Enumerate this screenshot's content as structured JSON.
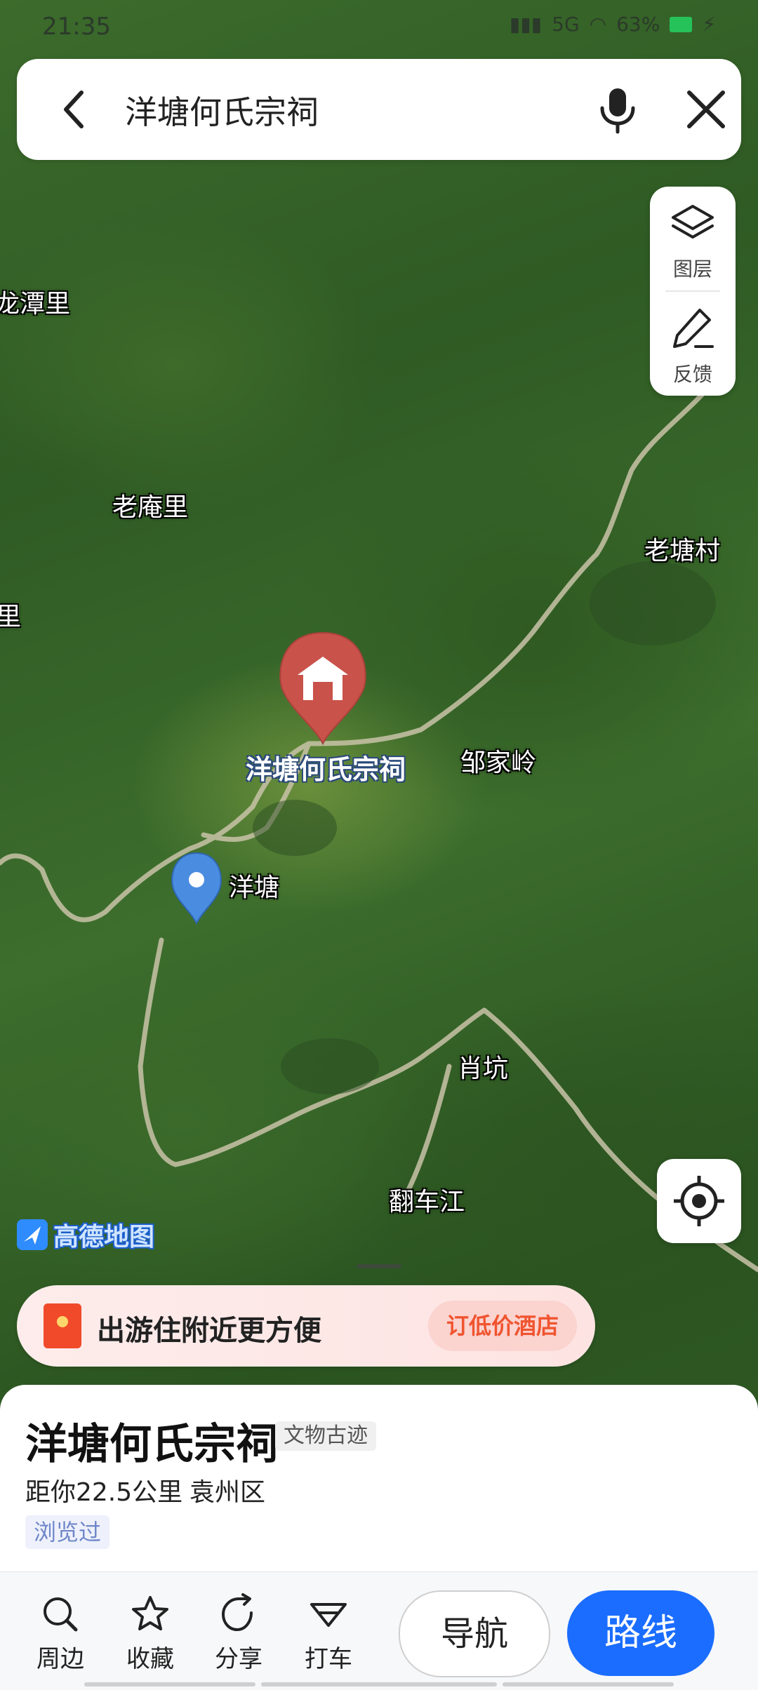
{
  "status_bar": {
    "time": "21:35",
    "network": "5G",
    "battery": "63%"
  },
  "search": {
    "query": "洋塘何氏宗祠"
  },
  "side_panel": {
    "layers_label": "图层",
    "feedback_label": "反馈"
  },
  "map": {
    "labels": [
      "龙潭里",
      "老庵里",
      "老塘村",
      "里",
      "邹家岭",
      "洋塘",
      "肖坑",
      "翻车江"
    ],
    "poi_label": "洋塘何氏宗祠",
    "logo_text": "高德地图"
  },
  "promo": {
    "text": "出游住附近更方便",
    "cta": "订低价酒店"
  },
  "place": {
    "name": "洋塘何氏宗祠",
    "category": "文物古迹",
    "distance": "距你22.5公里",
    "district": "袁州区",
    "viewed": "浏览过"
  },
  "bottom_bar": {
    "nearby": "周边",
    "favorite": "收藏",
    "share": "分享",
    "taxi": "打车",
    "navigate": "导航",
    "route": "路线"
  },
  "colors": {
    "accent": "#1a6dff",
    "poi_pin": "#c9524a",
    "promo_cta": "#f0542f"
  }
}
